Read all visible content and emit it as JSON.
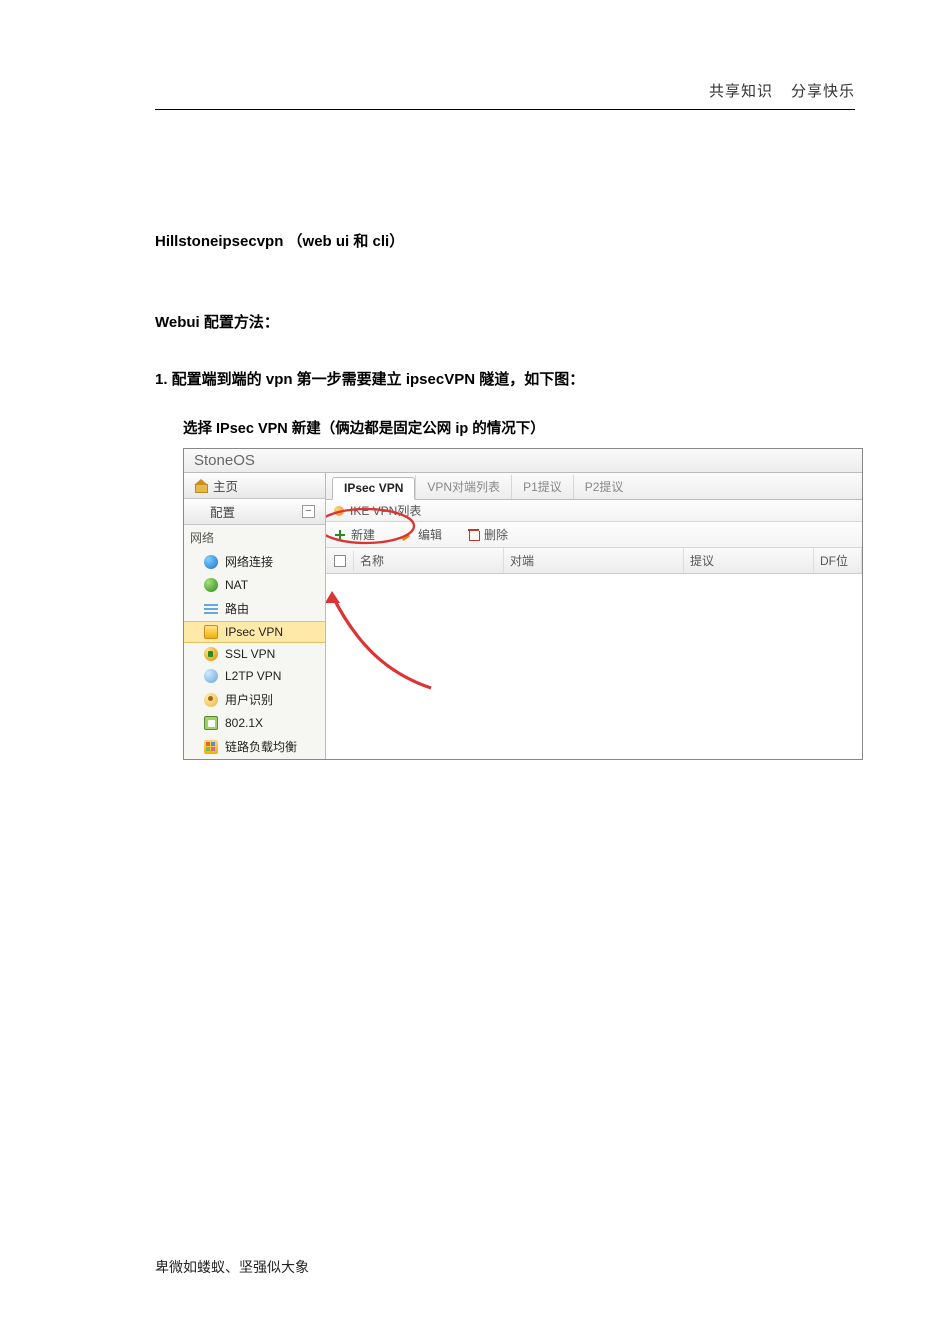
{
  "header": {
    "left": "共享知识",
    "right": "分享快乐"
  },
  "doc": {
    "title": "Hillstoneipsecvpn （web ui 和 cli）",
    "section": "Webui 配置方法：",
    "step": "1.   配置端到端的 vpn 第一步需要建立 ipsecVPN 隧道，如下图：",
    "sub": "选择 IPsec VPN   新建（俩边都是固定公网 ip 的情况下）"
  },
  "footer": "卑微如蝼蚁、坚强似大象",
  "ui": {
    "product": "StoneOS",
    "home": "主页",
    "config": "配置",
    "minus": "−",
    "group": "网络",
    "nav": {
      "netconn": "网络连接",
      "nat": "NAT",
      "route": "路由",
      "ipsec": "IPsec VPN",
      "ssl": "SSL VPN",
      "l2tp": "L2TP VPN",
      "user": "用户识别",
      "dot1x": "802.1X",
      "lb": "链路负载均衡"
    },
    "tabs": {
      "ipsec": "IPsec VPN",
      "peerlist": "VPN对端列表",
      "p1": "P1提议",
      "p2": "P2提议"
    },
    "subbar": "IKE VPN列表",
    "toolbar": {
      "new": "新建",
      "edit": "编辑",
      "delete": "删除"
    },
    "cols": {
      "name": "名称",
      "peer": "对端",
      "proposal": "提议",
      "df": "DF位"
    }
  }
}
